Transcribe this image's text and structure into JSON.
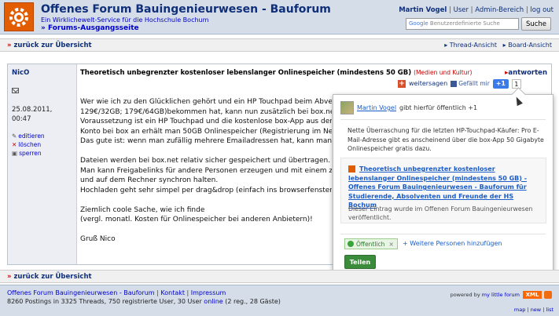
{
  "header": {
    "title": "Offenes Forum Bauingenieurwesen - Bauforum",
    "subtitle": "Ein Wirklichewelt-Service für die Hochschule Bochum",
    "section_link": "Forums-Ausgangsseite",
    "user_link": "Martin Vogel",
    "sep1": " | ",
    "user_label": "User",
    "sep2": " | ",
    "admin_link": "Admin-Bereich",
    "sep3": " | ",
    "logout_link": "log out",
    "search_brand": "Google",
    "search_placeholder": "Benutzerdefinierte Suche",
    "search_button": "Suche"
  },
  "nav_top": {
    "back_arrow": "»",
    "back_label": "zurück zur Übersicht",
    "thread_view": "Thread-Ansicht",
    "board_view": "Board-Ansicht"
  },
  "post": {
    "author": "NicO",
    "date": "25.08.2011,",
    "time": "00:47",
    "actions": [
      "editieren",
      "löschen",
      "sperren"
    ],
    "title": "Theoretisch unbegrenzter kostenloser lebenslanger Onlinespeicher (mindestens 50 GB)",
    "category": "(Medien und Kultur)",
    "reply_label": "antworten",
    "share_label": "weitersagen",
    "fb_label": "Gefällt mir",
    "plus1_label": "+1",
    "plus1_count": "1",
    "body": [
      "Wer wie ich zu den Glücklichen gehört und ein HP Touchpad beim Abverkauf ergattert hat (99€/16GB;",
      "129€/32GB; 179€/64GB)bekommen hat, kann nun zusätzlich bei box.net",
      "Voraussetzung ist ein HP Touchpad und die kostenlose box-App aus dem",
      "Konto bei box an erhält man 50GB Onlinespeicher (Registrierung im Netz",
      "Das gute ist: wenn man zufällig mehrere Emailadressen hat, kann man",
      "",
      "Dateien werden bei box.net relativ sicher gespeichert und übertragen.",
      "Man kann Freigabelinks für andere Personen erzeugen und mit einem zu",
      "und auf dem Rechner synchron halten.",
      "Hochladen geht sehr simpel per drag&drop (einfach ins browserfenster",
      "",
      "Ziemlich coole Sache, wie ich finde",
      "(vergl. monatl. Kosten für Onlinespeicher bei anderen Anbietern)!",
      "",
      "Gruß Nico"
    ]
  },
  "popup": {
    "user": "Martin Vogel",
    "action_text": "gibt hierfür öffentlich +1",
    "message": "Nette Überraschung für die letzten HP-Touchpad-Käufer: Pro E-Mail-Adresse gibt es anscheinend über die box-App 50 Gigabyte Onlinespeicher gratis dazu.",
    "link_title": "Theoretisch unbegrenzter kostenloser lebenslanger Onlinespeicher (mindestens 50 GB) - Offenes Forum Bauingenieurwesen - Bauforum für Studierende, Absolventen und Freunde der HS Bochum",
    "link_desc": "Dieser Eintrag wurde im Offenen Forum Bauingenieurwesen veröffentlicht.",
    "visibility": "Öffentlich",
    "visibility_remove": "×",
    "add_people": "+ Weitere Personen hinzufügen",
    "share_button": "Teilen"
  },
  "nav_bottom": {
    "back_arrow": "»",
    "back_label": "zurück zur Übersicht"
  },
  "footer": {
    "site_link": "Offenes Forum Bauingenieurwesen - Bauforum",
    "sep1": " | ",
    "contact": "Kontakt",
    "sep2": " | ",
    "impressum": "Impressum",
    "stats_text": "8260 Postings in 3325 Threads, 750 registrierte User, 30 User",
    "online_link": "online",
    "stats_tail": "(2 reg., 28 Gäste)",
    "powered_by": "powered by",
    "powered_link": "my little forum",
    "xml_badge": "XML",
    "map": "map",
    "new": "new",
    "list": "list",
    "ft_sep1": " | ",
    "ft_sep2": " | "
  },
  "colors": {
    "header_bg": "#d4dde8",
    "logo_orange": "#e25d00",
    "link_blue": "#0f2f7a",
    "plus1_blue": "#3b7be9",
    "share_green": "#3b8c3a"
  }
}
